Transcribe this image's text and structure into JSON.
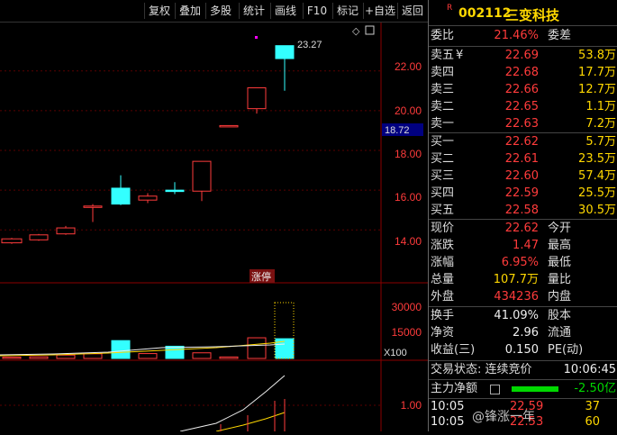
{
  "toolbar": {
    "buttons": [
      "复权",
      "叠加",
      "多股",
      "统计",
      "画线",
      "F10",
      "标记",
      "+自选",
      "返回"
    ]
  },
  "stock": {
    "badge": "R",
    "code": "002112",
    "name": "三变科技"
  },
  "summary": {
    "weibi_label": "委比",
    "weibi_value": "21.46%",
    "weicha_label": "委差"
  },
  "sell": [
    {
      "label": "卖五",
      "mark": "¥",
      "price": "22.69",
      "vol": "53.8万"
    },
    {
      "label": "卖四",
      "mark": "",
      "price": "22.68",
      "vol": "17.7万"
    },
    {
      "label": "卖三",
      "mark": "",
      "price": "22.66",
      "vol": "12.7万"
    },
    {
      "label": "卖二",
      "mark": "",
      "price": "22.65",
      "vol": "1.1万"
    },
    {
      "label": "卖一",
      "mark": "",
      "price": "22.63",
      "vol": "7.2万"
    }
  ],
  "buy": [
    {
      "label": "买一",
      "price": "22.62",
      "vol": "5.7万"
    },
    {
      "label": "买二",
      "price": "22.61",
      "vol": "23.5万"
    },
    {
      "label": "买三",
      "price": "22.60",
      "vol": "57.4万"
    },
    {
      "label": "买四",
      "price": "22.59",
      "vol": "25.5万"
    },
    {
      "label": "买五",
      "price": "22.58",
      "vol": "30.5万"
    }
  ],
  "quote": [
    {
      "label": "现价",
      "value": "22.62",
      "label2": "今开"
    },
    {
      "label": "涨跌",
      "value": "1.47",
      "label2": "最高"
    },
    {
      "label": "涨幅",
      "value": "6.95%",
      "label2": "最低"
    },
    {
      "label": "总量",
      "value": "107.7万",
      "label2": "量比"
    },
    {
      "label": "外盘",
      "value": "434236",
      "label2": "内盘"
    }
  ],
  "fundamentals": [
    {
      "label": "换手",
      "value": "41.09%",
      "label2": "股本"
    },
    {
      "label": "净资",
      "value": "2.96",
      "label2": "流通"
    },
    {
      "label": "收益(三)",
      "value": "0.150",
      "label2": "PE(动)"
    }
  ],
  "trade_status": {
    "label": "交易状态: 连续竞价",
    "time": "10:06:45"
  },
  "main_flow": {
    "label": "主力净额",
    "value": "-2.50亿"
  },
  "ticks": [
    {
      "time": "10:05",
      "price": "22.59",
      "vol": "37"
    },
    {
      "time": "10:05",
      "price": "22.53",
      "vol": "60"
    }
  ],
  "watermark": "@锋涨一年",
  "chart": {
    "price_ticks": [
      "22.00",
      "20.00",
      "18.00",
      "16.00",
      "14.00"
    ],
    "current_price": "18.72",
    "high_label": "23.27",
    "zt_label": "涨停",
    "vol_ticks": [
      "30000",
      "15000"
    ],
    "vol_unit": "X100",
    "macd_tick": "1.00"
  },
  "chart_data": {
    "type": "candlestick",
    "candles": [
      {
        "open": 13.35,
        "close": 13.55,
        "high": 13.6,
        "low": 13.3
      },
      {
        "open": 13.5,
        "close": 13.75,
        "high": 13.8,
        "low": 13.45
      },
      {
        "open": 13.8,
        "close": 14.1,
        "high": 14.2,
        "low": 13.75
      },
      {
        "open": 15.15,
        "close": 15.2,
        "high": 15.3,
        "low": 14.4
      },
      {
        "open": 16.1,
        "close": 15.3,
        "high": 16.75,
        "low": 15.25
      },
      {
        "open": 15.5,
        "close": 15.7,
        "high": 15.85,
        "low": 15.35
      },
      {
        "open": 15.95,
        "close": 16.0,
        "high": 16.4,
        "low": 15.8
      },
      {
        "open": 15.95,
        "close": 17.45,
        "high": 17.45,
        "low": 15.45
      },
      {
        "open": 19.25,
        "close": 19.25,
        "high": 19.25,
        "low": 19.25
      },
      {
        "open": 20.1,
        "close": 21.15,
        "high": 21.15,
        "low": 19.85
      },
      {
        "open": 23.27,
        "close": 22.62,
        "high": 23.27,
        "low": 21.0
      }
    ],
    "volumes": [
      700,
      900,
      1800,
      2500,
      9500,
      2600,
      6500,
      3000,
      800,
      11000,
      10500
    ],
    "ylim": [
      12.2,
      23.8
    ],
    "vol_ylim": [
      0,
      35000
    ]
  }
}
